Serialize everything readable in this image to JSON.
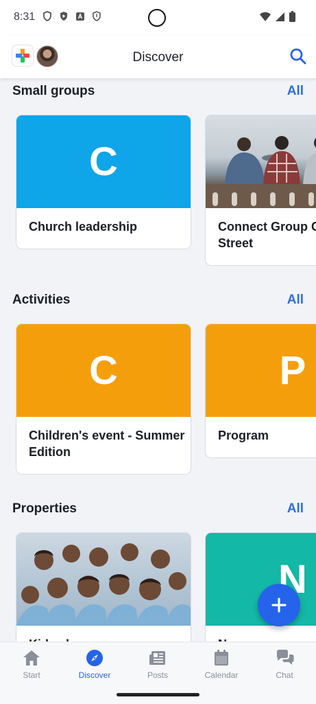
{
  "status_bar": {
    "time": "8:31"
  },
  "app_bar": {
    "title": "Discover"
  },
  "sections": [
    {
      "title": "Small groups",
      "all_label": "All",
      "cards": [
        {
          "letter": "C",
          "title": "Church leadership",
          "color": "#0ea5e9",
          "image": ""
        },
        {
          "letter": "",
          "title": "Connect Group C\nStreet",
          "color": "#8a9aa8",
          "image": "people-on-wall-photo"
        }
      ]
    },
    {
      "title": "Activities",
      "all_label": "All",
      "cards": [
        {
          "letter": "C",
          "title": "Children's event - Summer\nEdition",
          "color": "#f59e0b"
        },
        {
          "letter": "P",
          "title": "Program",
          "color": "#f59e0b"
        }
      ]
    },
    {
      "title": "Properties",
      "all_label": "All",
      "cards": [
        {
          "letter": "",
          "title": "Kids ch…",
          "color": "#7da4c8",
          "image": "children-group-photo"
        },
        {
          "letter": "N",
          "title": "N…",
          "color": "#14b8a6"
        }
      ]
    }
  ],
  "fab": {
    "icon": "plus-icon"
  },
  "bottom_nav": [
    {
      "label": "Start",
      "icon": "home-icon",
      "active": false
    },
    {
      "label": "Discover",
      "icon": "compass-icon",
      "active": true
    },
    {
      "label": "Posts",
      "icon": "newspaper-icon",
      "active": false
    },
    {
      "label": "Calendar",
      "icon": "calendar-icon",
      "active": false
    },
    {
      "label": "Chat",
      "icon": "chat-icon",
      "active": false
    }
  ],
  "colors": {
    "accent": "#2563eb",
    "link": "#2f6fe0"
  }
}
